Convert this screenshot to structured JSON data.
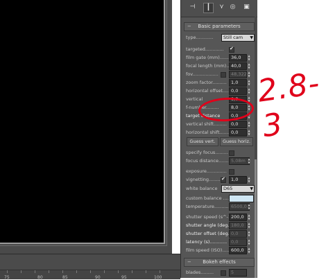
{
  "toolbar": {
    "icons": [
      "pin-icon",
      "modify-icon",
      "hierarchy-icon",
      "motion-icon",
      "display-icon"
    ]
  },
  "basic": {
    "title": "Basic parameters",
    "type_label": "type............",
    "type_value": "Still cam",
    "targeted_label": "targeted.............",
    "film_gate_label": "film gate (mm)........",
    "film_gate_value": "36,0",
    "focal_label": "focal length (mm).....",
    "focal_value": "40,0",
    "fov_label": "fov..................",
    "fov_value": "48,322",
    "zoom_label": "zoom factor..........",
    "zoom_value": "1,0",
    "hoffset_label": "horizontal offset.....",
    "hoffset_value": "0,0",
    "vertical_label": "vertical",
    "vertical_value": "0,0",
    "fnum_label": "f-number.........",
    "fnum_value": "8,0",
    "target_dist_label": "target distance",
    "target_dist_value": "0,0",
    "vshift_label": "vertical shift.........",
    "vshift_value": "0,0",
    "hshift_label": "horizontal shift.......",
    "hshift_value": "0,0",
    "guess_vert": "Guess vert.",
    "guess_horiz": "Guess horiz.",
    "specify_focus_label": "specify focus.........",
    "focus_dist_label": "focus distance........",
    "focus_dist_value": "5,08m",
    "exposure_label": "exposure..............",
    "vignetting_label": "vignetting...........",
    "vignetting_value": "1,0",
    "wb_label": "white balance",
    "wb_value": "D65",
    "custom_balance_label": "custom balance ..........",
    "temperature_label": "temperature...........",
    "temperature_value": "6500,0",
    "shutter_speed_label": "shutter speed (s^-1",
    "shutter_speed_value": "200,0",
    "shutter_angle_label": "shutter angle (deg.)",
    "shutter_angle_value": "180,0",
    "shutter_offset_label": "shutter offset (deg.)",
    "shutter_offset_value": "0,0",
    "latency_label": "latency (s)............",
    "latency_value": "0,0",
    "iso_label": "film speed (ISO).......",
    "iso_value": "600,0"
  },
  "bokeh": {
    "title": "Bokeh effects",
    "blades_label": "blades.........",
    "blades_value": "5"
  },
  "timeline": {
    "ticks": [
      "75",
      "80",
      "85",
      "90",
      "95",
      "100"
    ]
  },
  "annotation": {
    "text": "2.8-3"
  }
}
